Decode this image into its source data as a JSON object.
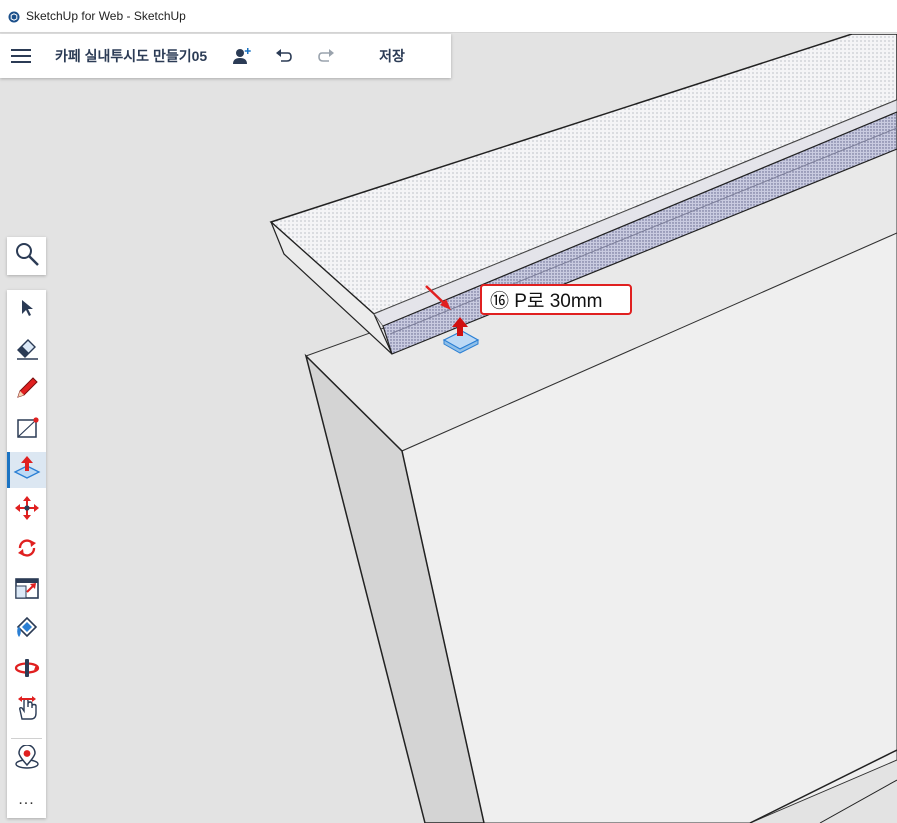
{
  "window": {
    "title": "SketchUp for Web - SketchUp",
    "logo_icon": "sketchup-logo-icon"
  },
  "topbar": {
    "menu_icon": "hamburger-menu-icon",
    "document_title": "카페 실내투시도 만들기05",
    "share_icon": "add-user-icon",
    "undo_icon": "undo-icon",
    "redo_icon": "redo-icon",
    "save_label": "저장"
  },
  "search_tool": {
    "icon": "magnifier-icon"
  },
  "toolbar": {
    "active_tool": "push-pull",
    "tools": [
      {
        "id": "select",
        "icon": "select-arrow-icon"
      },
      {
        "id": "eraser",
        "icon": "eraser-icon"
      },
      {
        "id": "pencil",
        "icon": "pencil-icon"
      },
      {
        "id": "line-rectangle",
        "icon": "rectangle-line-icon"
      },
      {
        "id": "push-pull",
        "icon": "push-pull-icon"
      },
      {
        "id": "move",
        "icon": "move-arrows-icon"
      },
      {
        "id": "rotate",
        "icon": "rotate-icon"
      },
      {
        "id": "scale",
        "icon": "scale-icon"
      },
      {
        "id": "paint",
        "icon": "paint-bucket-icon"
      },
      {
        "id": "orbit",
        "icon": "orbit-icon"
      },
      {
        "id": "pan",
        "icon": "pan-hand-icon"
      },
      {
        "id": "position-camera",
        "icon": "position-camera-icon"
      },
      {
        "id": "more",
        "icon": "more-dots-icon",
        "label": "..."
      }
    ]
  },
  "annotation": {
    "text": "⑯ P로 30mm",
    "border_color": "#e02020"
  },
  "colors": {
    "accent": "#1b73c2",
    "tool_red": "#e02020",
    "background": "#e3e3e3"
  }
}
